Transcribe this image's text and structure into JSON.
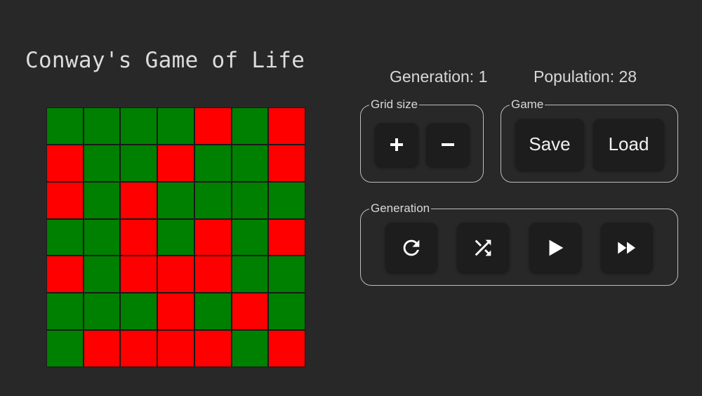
{
  "app": {
    "title": "Conway's Game of Life"
  },
  "stats": {
    "generation_label": "Generation: 1",
    "population_label": "Population: 28"
  },
  "board": {
    "rows": 7,
    "cols": 7,
    "alive_color": "#ff0000",
    "dead_color": "#008000",
    "cells": [
      [
        0,
        0,
        0,
        0,
        1,
        0,
        1
      ],
      [
        1,
        0,
        0,
        1,
        0,
        0,
        1
      ],
      [
        1,
        0,
        1,
        0,
        0,
        0,
        0
      ],
      [
        0,
        0,
        1,
        0,
        1,
        0,
        1
      ],
      [
        1,
        0,
        1,
        1,
        1,
        0,
        0
      ],
      [
        0,
        0,
        0,
        1,
        0,
        1,
        0
      ],
      [
        0,
        1,
        1,
        1,
        1,
        0,
        1
      ]
    ]
  },
  "grid_size_group": {
    "legend": "Grid size",
    "increase_icon": "plus-icon",
    "decrease_icon": "minus-icon"
  },
  "game_group": {
    "legend": "Game",
    "save_label": "Save",
    "load_label": "Load"
  },
  "generation_group": {
    "legend": "Generation",
    "buttons": [
      {
        "icon": "reset-icon"
      },
      {
        "icon": "shuffle-icon"
      },
      {
        "icon": "play-icon"
      },
      {
        "icon": "fast-forward-icon"
      }
    ]
  }
}
